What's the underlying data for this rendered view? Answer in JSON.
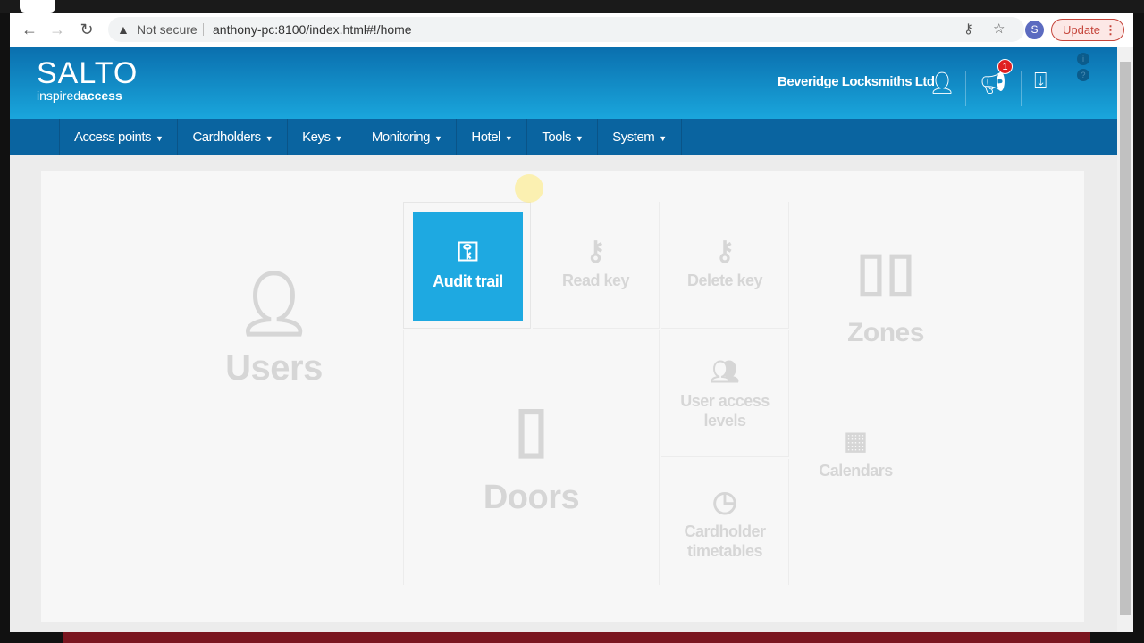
{
  "browser": {
    "security": "Not secure",
    "url": "anthony-pc:8100/index.html#!/home",
    "profile": "S",
    "update_label": "Update"
  },
  "app": {
    "logo_main": "SALTO",
    "logo_sub_light": "inspired",
    "logo_sub_bold": "access",
    "company": "Beveridge Locksmiths Ltd",
    "notification_count": "1",
    "accent": "#1ea9e1"
  },
  "nav": [
    {
      "label": "Access points"
    },
    {
      "label": "Cardholders"
    },
    {
      "label": "Keys"
    },
    {
      "label": "Monitoring"
    },
    {
      "label": "Hotel"
    },
    {
      "label": "Tools"
    },
    {
      "label": "System"
    }
  ],
  "tiles": {
    "users": "Users",
    "audit_trail": "Audit trail",
    "read_key": "Read key",
    "delete_key": "Delete key",
    "zones": "Zones",
    "doors": "Doors",
    "user_access_levels": "User access levels",
    "cardholder_timetables": "Cardholder timetables",
    "calendars": "Calendars"
  }
}
